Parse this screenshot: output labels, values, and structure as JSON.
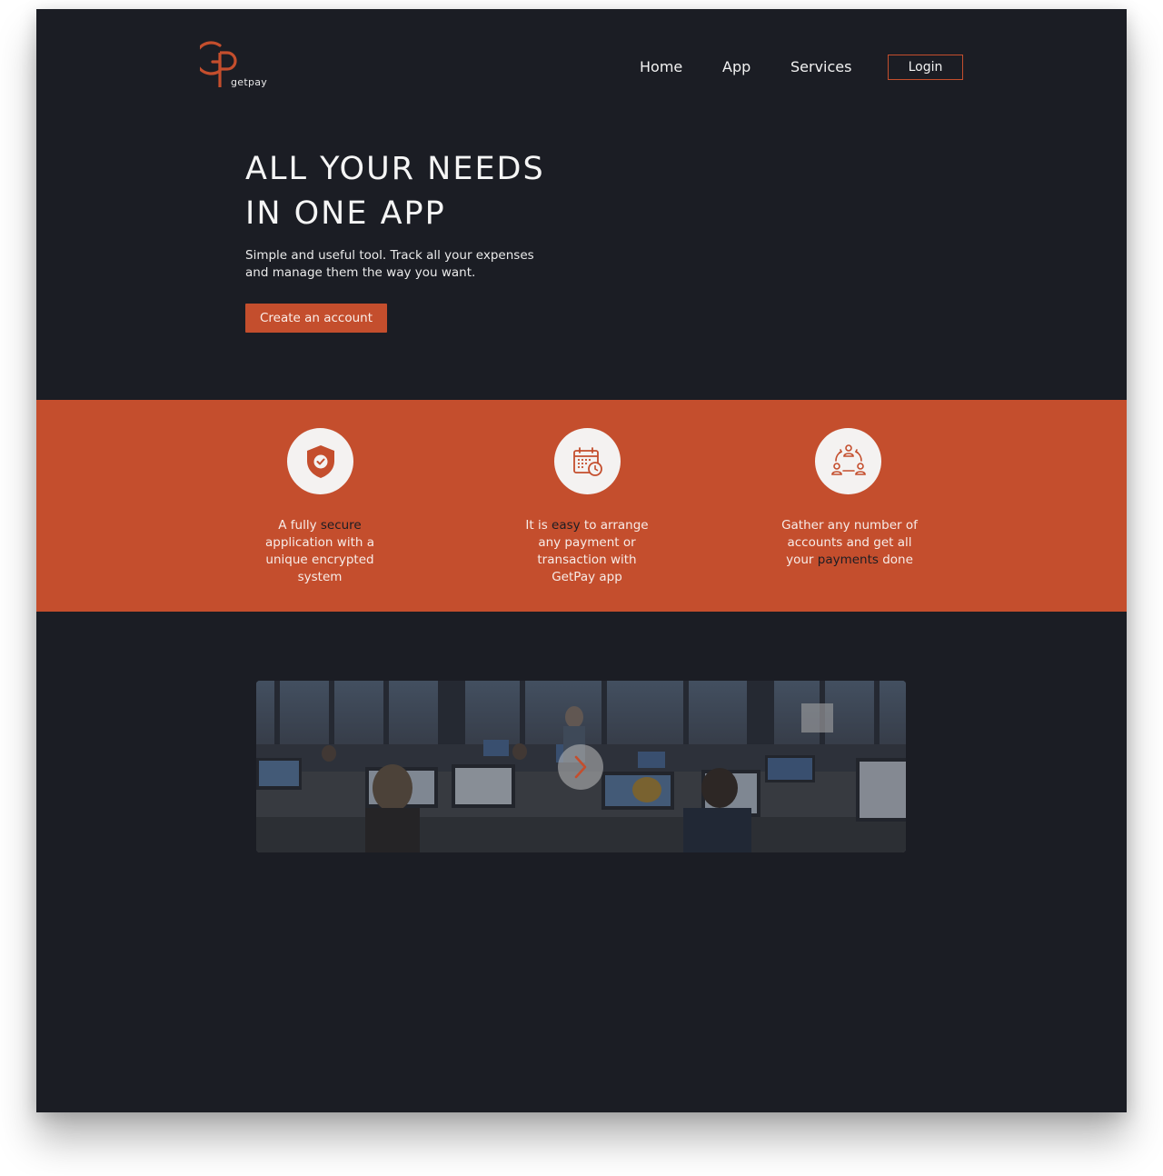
{
  "brand": {
    "name": "getpay",
    "accent": "#c44e2d",
    "background": "#1b1d24"
  },
  "nav": {
    "items": [
      "Home",
      "App",
      "Services"
    ],
    "login_label": "Login"
  },
  "hero": {
    "title_line1": "ALL YOUR NEEDS",
    "title_line2": "IN ONE APP",
    "subtitle": "Simple and useful tool. Track all your expenses and manage them the way you want.",
    "cta_label": "Create an account"
  },
  "features": [
    {
      "icon": "shield-check-icon",
      "before": "A fully ",
      "highlight": "secure",
      "after": " application with a unique encrypted system"
    },
    {
      "icon": "calendar-clock-icon",
      "before": "It is ",
      "highlight": "easy",
      "after": " to arrange any payment or transaction with GetPay app"
    },
    {
      "icon": "users-network-icon",
      "before": "Gather any number of accounts and get all your ",
      "highlight": "payments",
      "after": " done"
    }
  ],
  "gallery": {
    "image": "office-workspace-photo",
    "next_icon": "chevron-right-icon"
  }
}
